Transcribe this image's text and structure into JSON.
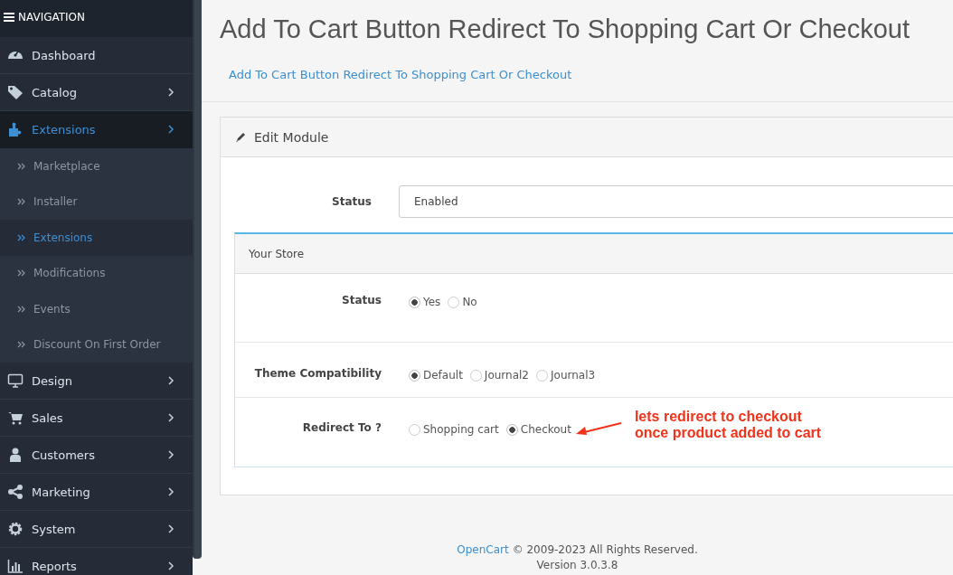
{
  "sidebar": {
    "title": "NAVIGATION",
    "items": [
      {
        "label": "Dashboard",
        "selected": false,
        "has_children": false
      },
      {
        "label": "Catalog",
        "selected": false,
        "has_children": true
      },
      {
        "label": "Extensions",
        "selected": true,
        "has_children": true,
        "children": [
          {
            "label": "Marketplace",
            "selected": false
          },
          {
            "label": "Installer",
            "selected": false
          },
          {
            "label": "Extensions",
            "selected": true
          },
          {
            "label": "Modifications",
            "selected": false
          },
          {
            "label": "Events",
            "selected": false
          },
          {
            "label": "Discount On First Order",
            "selected": false
          }
        ]
      },
      {
        "label": "Design",
        "selected": false,
        "has_children": true
      },
      {
        "label": "Sales",
        "selected": false,
        "has_children": true
      },
      {
        "label": "Customers",
        "selected": false,
        "has_children": true
      },
      {
        "label": "Marketing",
        "selected": false,
        "has_children": true
      },
      {
        "label": "System",
        "selected": false,
        "has_children": true
      },
      {
        "label": "Reports",
        "selected": false,
        "has_children": true
      }
    ]
  },
  "page": {
    "title": "Add To Cart Button Redirect To Shopping Cart Or Checkout",
    "breadcrumb": [
      "Add To Cart Button Redirect To Shopping Cart Or Checkout"
    ]
  },
  "panel": {
    "title": "Edit Module",
    "status": {
      "label": "Status",
      "value": "Enabled"
    },
    "store_panel": {
      "title": "Your Store",
      "rows": [
        {
          "label": "Status",
          "options": [
            {
              "label": "Yes",
              "selected": true
            },
            {
              "label": "No",
              "selected": false
            }
          ]
        },
        {
          "label": "Theme Compatibility",
          "options": [
            {
              "label": "Default",
              "selected": true
            },
            {
              "label": "Journal2",
              "selected": false
            },
            {
              "label": "Journal3",
              "selected": false
            }
          ]
        },
        {
          "label": "Redirect To ?",
          "options": [
            {
              "label": "Shopping cart",
              "selected": false
            },
            {
              "label": "Checkout",
              "selected": true
            }
          ],
          "annotation": [
            "lets redirect to checkout",
            "once product added to cart"
          ]
        }
      ]
    }
  },
  "footer": {
    "link": "OpenCart",
    "text": "© 2009-2023 All Rights Reserved.",
    "version": "Version 3.0.3.8"
  }
}
